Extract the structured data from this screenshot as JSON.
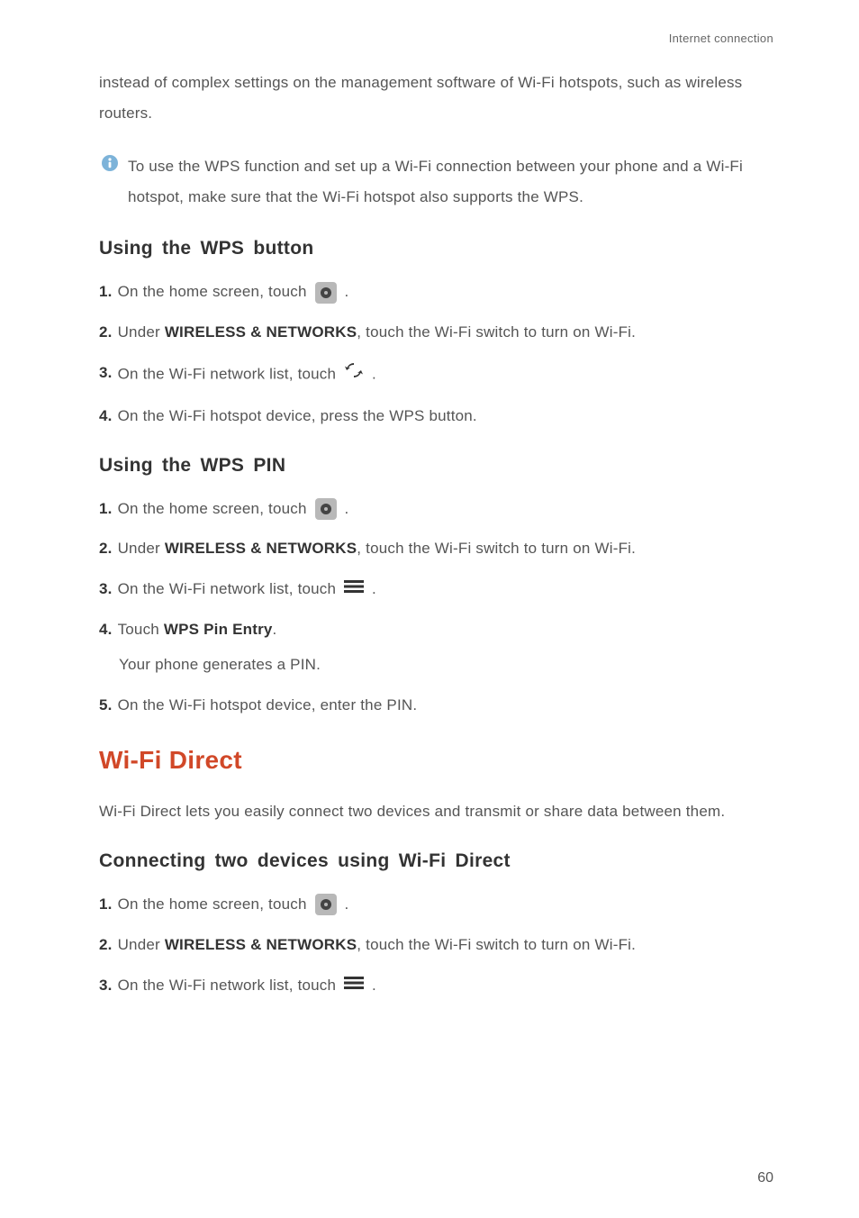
{
  "header": {
    "section_label": "Internet connection"
  },
  "intro": "instead of complex settings on the management software of Wi-Fi hotspots, such as wireless routers.",
  "info_note": "To use the WPS function and set up a Wi-Fi connection between your phone and a Wi-Fi hotspot, make sure that the Wi-Fi hotspot also supports the WPS.",
  "wps_button": {
    "heading": "Using the WPS button",
    "steps": {
      "s1_pre": "On the home screen, touch ",
      "s1_post": " .",
      "s2_pre": "Under ",
      "s2_bold": "WIRELESS & NETWORKS",
      "s2_post": ", touch the Wi-Fi switch to turn on Wi-Fi.",
      "s3_pre": "On the Wi-Fi network list, touch ",
      "s3_post": " .",
      "s4": "On the Wi-Fi hotspot device, press the WPS button."
    }
  },
  "wps_pin": {
    "heading": "Using the WPS PIN",
    "steps": {
      "s1_pre": "On the home screen, touch ",
      "s1_post": " .",
      "s2_pre": "Under ",
      "s2_bold": "WIRELESS & NETWORKS",
      "s2_post": ", touch the Wi-Fi switch to turn on Wi-Fi.",
      "s3_pre": "On the Wi-Fi network list, touch ",
      "s3_post": ".",
      "s4_pre": "Touch ",
      "s4_bold": "WPS Pin Entry",
      "s4_post": ".",
      "s4_sub": "Your phone generates a PIN.",
      "s5": "On the Wi-Fi hotspot device, enter the PIN."
    }
  },
  "wifi_direct": {
    "title": "Wi-Fi Direct",
    "desc": "Wi-Fi Direct lets you easily connect two devices and transmit or share data between them.",
    "heading": "Connecting two devices using Wi-Fi Direct",
    "steps": {
      "s1_pre": "On the home screen, touch ",
      "s1_post": " .",
      "s2_pre": "Under ",
      "s2_bold": "WIRELESS & NETWORKS",
      "s2_post": ", touch the Wi-Fi switch to turn on Wi-Fi.",
      "s3_pre": "On the Wi-Fi network list, touch ",
      "s3_post": "."
    }
  },
  "page_number": "60",
  "nums": {
    "n1": "1.",
    "n2": "2.",
    "n3": "3.",
    "n4": "4.",
    "n5": "5."
  }
}
